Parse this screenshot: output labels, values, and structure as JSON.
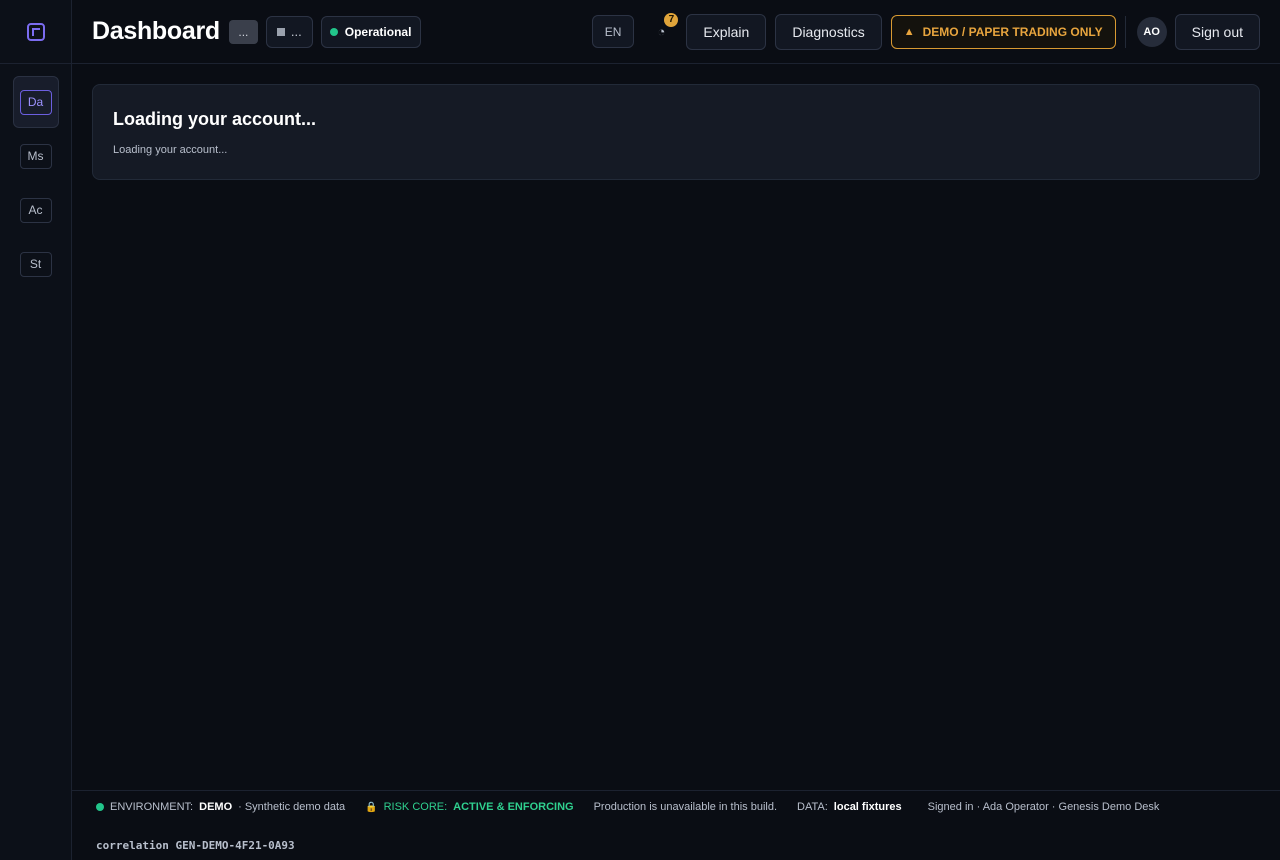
{
  "sidebar": {
    "logo": "app-logo-icon",
    "items": [
      {
        "label": "Da",
        "active": true
      },
      {
        "label": "Ms",
        "active": false
      },
      {
        "label": "Ac",
        "active": false
      },
      {
        "label": "St",
        "active": false
      }
    ]
  },
  "header": {
    "title": "Dashboard",
    "ellipsis_pill": "...",
    "square_button_label": "...",
    "status_label": "Operational",
    "language": "EN",
    "notification_count": "7",
    "explain_label": "Explain",
    "diagnostics_label": "Diagnostics",
    "demo_banner": "DEMO / PAPER TRADING ONLY",
    "avatar_initials": "AO",
    "signout_label": "Sign out"
  },
  "main": {
    "card_title": "Loading your account...",
    "card_subtitle": "Loading your account..."
  },
  "footer": {
    "env_label": "ENVIRONMENT:",
    "env_value": "DEMO",
    "env_note": "· Synthetic demo data",
    "risk_label": "RISK CORE:",
    "risk_value": "ACTIVE & ENFORCING",
    "production_note": "Production is unavailable in this build.",
    "data_label": "DATA:",
    "data_value": "local fixtures",
    "signed_in": "Signed in · Ada Operator · Genesis Demo Desk",
    "correlation": "correlation GEN-DEMO-4F21-0A93"
  },
  "colors": {
    "accent": "#7b6cf0",
    "status_green": "#22c58b",
    "warning_amber": "#e0a43a",
    "background": "#0a0d14"
  }
}
